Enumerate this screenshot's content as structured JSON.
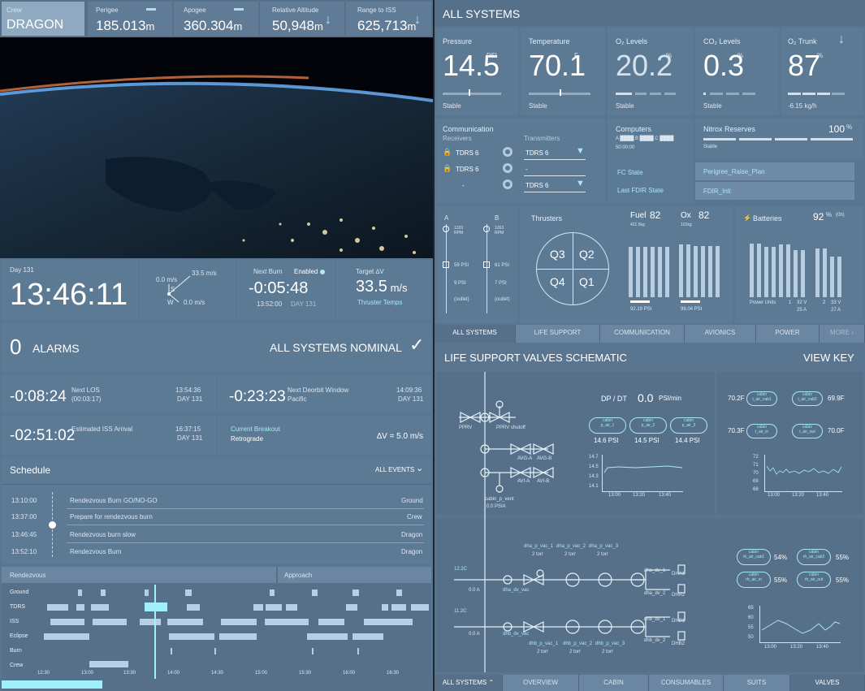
{
  "top_bar": {
    "crew": {
      "label": "Crew",
      "value": "DRAGON"
    },
    "perigee": {
      "label": "Perigee",
      "value": "185.013",
      "unit": "m"
    },
    "apogee": {
      "label": "Apogee",
      "value": "360.304",
      "unit": "m"
    },
    "rel_alt": {
      "label": "Relative Altitude",
      "value": "50,948",
      "unit": "m"
    },
    "range_iss": {
      "label": "Range to ISS",
      "value": "625,713",
      "unit": "m"
    }
  },
  "clock": {
    "day": "Day 131",
    "time": "13:46:11"
  },
  "vector": {
    "v1": "33.5 m/s",
    "v2": "0.0 m/s",
    "v3": "0.0 m/s",
    "axes": [
      "S",
      "W"
    ]
  },
  "next_burn": {
    "label": "Next Burn",
    "status": "Enabled",
    "countdown": "-0:05:48",
    "time": "13:52:00",
    "day": "DAY 131"
  },
  "target_dv": {
    "label": "Target ∆V",
    "value": "33.5",
    "unit": "m/s",
    "sub": "Thruster Temps"
  },
  "alarms": {
    "count": "0",
    "label": "ALARMS",
    "status": "ALL SYSTEMS NOMINAL"
  },
  "events": [
    {
      "countdown": "-0:08:24",
      "name": "Next LOS",
      "sub": "(00:03:17)",
      "time": "13:54:36",
      "day": "DAY 131"
    },
    {
      "countdown": "-0:23:23",
      "name": "Next Deorbit Window",
      "sub": "Pacific",
      "time": "14:09:36",
      "day": "DAY 131"
    },
    {
      "countdown": "-02:51:02",
      "name": "Estimated ISS Arrival",
      "sub": "",
      "time": "16:37:15",
      "day": "DAY 131"
    }
  ],
  "breakout": {
    "label": "Current Breakout",
    "value": "Retrograde",
    "dv": "∆V = 5.0 m/s"
  },
  "schedule": {
    "title": "Schedule",
    "filter": "ALL EVENTS",
    "items": [
      {
        "time": "13:10:00",
        "name": "Rendezvous Burn GO/NO-GO",
        "owner": "Ground"
      },
      {
        "time": "13:37:00",
        "name": "Prepare for rendezvous burn",
        "owner": "Crew"
      },
      {
        "time": "13:46:45",
        "name": "Rendezvous burn slow",
        "owner": "Dragon"
      },
      {
        "time": "13:52:10",
        "name": "Rendezvous Burn",
        "owner": "Dragon"
      }
    ]
  },
  "timeline": {
    "phases": [
      "Rendezvous",
      "Approach"
    ],
    "rows": [
      "Ground",
      "TDRS",
      "ISS",
      "Eclipse",
      "Burn",
      "Crew"
    ],
    "ticks": [
      "12:30",
      "13:00",
      "13:30",
      "14:00",
      "14:30",
      "15:00",
      "15:30",
      "16:00",
      "16:30"
    ]
  },
  "systems": {
    "title": "ALL SYSTEMS",
    "gauges": [
      {
        "label": "Pressure",
        "value": "14.5",
        "unit": "PSI",
        "status": "Stable"
      },
      {
        "label": "Temperature",
        "value": "70.1",
        "unit": "F",
        "status": "Stable"
      },
      {
        "label": "O₂ Levels",
        "value": "20.2",
        "unit": "%",
        "status": "Stable"
      },
      {
        "label": "CO₂ Levels",
        "value": "0.3",
        "unit": "%",
        "status": "Stable"
      },
      {
        "label": "O₂ Trunk",
        "value": "87",
        "unit": "%",
        "status": "-6.15 kg/h"
      }
    ]
  },
  "comms": {
    "title": "Communication",
    "receivers_label": "Receivers",
    "transmitters_label": "Transmitters",
    "receivers": [
      "TDRS 6",
      "TDRS 6",
      "-"
    ],
    "transmitters": [
      "TDRS 6",
      "-",
      "TDRS 6"
    ]
  },
  "computers": {
    "title": "Computers",
    "abc": "A ████ B ████ C ████",
    "time": "50:00:00",
    "fc_label": "FC State",
    "fc_value": "Perigree_Raise_Plan",
    "fdir_label": "Last FDIR State",
    "fdir_value": "FDIR_Init"
  },
  "nitrox": {
    "title": "Nitrox Reserves",
    "value": "100",
    "unit": "%",
    "status": "Stable"
  },
  "pumps": {
    "a": "A",
    "b": "B",
    "rpm_a": "1333 RPM",
    "rpm_b": "1263 RPM",
    "psi_a1": "59 PSI",
    "psi_b1": "61 PSI",
    "psi_a2": "9 PSI",
    "psi_b2": "7 PSI",
    "outlet": "(outlet)"
  },
  "thrusters": {
    "title": "Thrusters",
    "quads": [
      "Q3",
      "Q2",
      "Q4",
      "Q1"
    ],
    "fuel_label": "Fuel",
    "fuel_value": "82",
    "fuel_sub": "421.5kg",
    "ox_label": "Ox",
    "ox_value": "82",
    "ox_sub": "101kg",
    "psi1": "92.19 PSI",
    "psi2": "98.04 PSI"
  },
  "batteries": {
    "title": "Batteries",
    "value": "92",
    "unit": "%",
    "sub": "(0h)",
    "power_units": "Power Units",
    "u1": "1",
    "v1": "32 V",
    "a1": "25 A",
    "u2": "2",
    "v2": "33 V",
    "a2": "27 A"
  },
  "tabs_top": [
    "ALL SYSTEMS",
    "LIFE SUPPORT",
    "COMMUNICATION",
    "AVIONICS",
    "POWER",
    "MORE"
  ],
  "schematic": {
    "title": "LIFE SUPPORT VALVES SCHEMATIC",
    "key": "VIEW KEY",
    "dp_label": "DP / DT",
    "dp_value": "0.0",
    "dp_unit": "PSI/min",
    "labels": [
      "PPRV",
      "PPRV shutoff",
      "AVG-A",
      "AVG-B",
      "AVI-A",
      "AVI-B",
      "cabin_p_vent",
      "0.0 PSIA"
    ],
    "cabin_p": [
      {
        "t": "cabin",
        "s": "p_air_1",
        "v": "14.6 PSI"
      },
      {
        "t": "cabin",
        "s": "p_air_2",
        "v": "14.5 PSI"
      },
      {
        "t": "cabin",
        "s": "p_air_3",
        "v": "14.4 PSI"
      }
    ],
    "chart1_y": [
      "14.7",
      "14.5",
      "14.3",
      "14.1"
    ],
    "chart1_x": [
      "13:00",
      "13:20",
      "13:40"
    ],
    "temps": [
      {
        "v": "70.2F",
        "s": "t_air_cab1"
      },
      {
        "v": "69.9F",
        "s": "t_air_cab2"
      },
      {
        "v": "70.3F",
        "s": "t_air_in"
      },
      {
        "v": "70.0F",
        "s": "t_air_out"
      }
    ],
    "chart2_y": [
      "72",
      "71",
      "70",
      "69",
      "68"
    ],
    "chart2_x": [
      "13:00",
      "13:20",
      "13:40"
    ],
    "dha": [
      "dha_p_vac_1",
      "dha_p_vac_2",
      "dha_p_vac_3"
    ],
    "dhb": [
      "dhb_p_vac_1",
      "dhb_p_vac_2",
      "dhb_p_vac_3"
    ],
    "torr": "2 torr",
    "t1": "12.2C",
    "t2": "11.2C",
    "amp": "0.0 A",
    "dha_dv": "dha_dv_vac",
    "dhb_dv": "dhb_dv_vac",
    "dha_out": [
      "dha_dv_1",
      "dha_dv_2"
    ],
    "dhb_out": [
      "dhb_dv_1",
      "dhb_dv_2"
    ],
    "dha_units": [
      "DHA1",
      "DHA2"
    ],
    "dhb_units": [
      "DHB1",
      "DHB2"
    ],
    "hum": [
      {
        "v": "54%",
        "s": "rh_air_cab1"
      },
      {
        "v": "55%",
        "s": "rh_air_cab2"
      },
      {
        "v": "55%",
        "s": "rh_air_in"
      },
      {
        "v": "55%",
        "s": "rh_air_out"
      }
    ],
    "chart3_y": [
      "65",
      "60",
      "55",
      "50"
    ],
    "chart3_x": [
      "13:00",
      "13:20",
      "13:40"
    ]
  },
  "tabs_bottom": [
    "ALL SYSTEMS",
    "OVERVIEW",
    "CABIN",
    "CONSUMABLES",
    "SUITS",
    "VALVES"
  ]
}
